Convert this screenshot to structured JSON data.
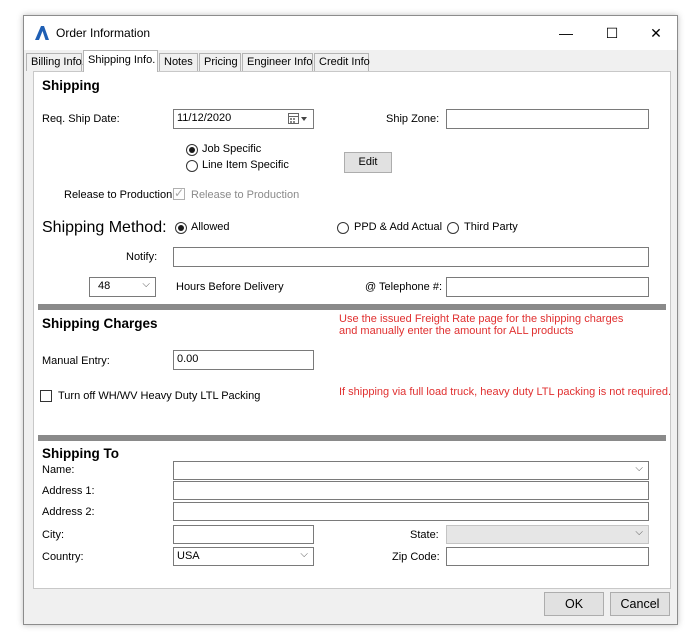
{
  "window": {
    "title": "Order Information",
    "minimize_glyph": "—",
    "maximize_glyph": "☐",
    "close_glyph": "✕"
  },
  "tabs": [
    {
      "label": "Billing Info."
    },
    {
      "label": "Shipping Info."
    },
    {
      "label": "Notes"
    },
    {
      "label": "Pricing"
    },
    {
      "label": "Engineer Info"
    },
    {
      "label": "Credit Info"
    }
  ],
  "active_tab": "Shipping Info.",
  "shipping": {
    "section_title": "Shipping",
    "req_ship_date_label": "Req. Ship Date:",
    "req_ship_date_value": "11/12/2020",
    "ship_zone_label": "Ship Zone:",
    "ship_zone_value": "",
    "scope_options": [
      "Job Specific",
      "Line Item Specific"
    ],
    "scope_selected": "Job Specific",
    "edit_button": "Edit",
    "release_label": "Release to Production",
    "release_checkbox_label": "Release to Production",
    "release_checked": true,
    "release_enabled": false,
    "method_label": "Shipping Method:",
    "method_options": [
      "Allowed",
      "PPD & Add Actual",
      "Third Party"
    ],
    "method_selected": "Allowed",
    "notify_label": "Notify:",
    "notify_value": "",
    "hours_value": "48",
    "hours_label": "Hours Before Delivery",
    "telephone_label": "@ Telephone #:",
    "telephone_value": ""
  },
  "charges": {
    "section_title": "Shipping Charges",
    "note_line1": "Use the issued Freight Rate page for the shipping charges",
    "note_line2": "and manually enter the amount for ALL products",
    "manual_entry_label": "Manual Entry:",
    "manual_entry_value": "0.00",
    "ltl_checkbox_label": "Turn off WH/WV Heavy Duty LTL Packing",
    "ltl_checked": false,
    "ltl_note": "If shipping via full load truck, heavy duty LTL packing is not required."
  },
  "shipping_to": {
    "section_title": "Shipping To",
    "name_label": "Name:",
    "name_value": "",
    "address1_label": "Address 1:",
    "address1_value": "",
    "address2_label": "Address 2:",
    "address2_value": "",
    "city_label": "City:",
    "city_value": "",
    "state_label": "State:",
    "state_value": "",
    "country_label": "Country:",
    "country_value": "USA",
    "zip_label": "Zip Code:",
    "zip_value": ""
  },
  "footer": {
    "ok_label": "OK",
    "cancel_label": "Cancel"
  },
  "colors": {
    "accent_icon": "#1f5fb4",
    "note_red": "#e03030",
    "separator": "#8a8a8a"
  },
  "icons": {
    "app": "app-logo-icon",
    "calendar": "calendar-icon",
    "dropdown": "chevron-down-icon"
  }
}
